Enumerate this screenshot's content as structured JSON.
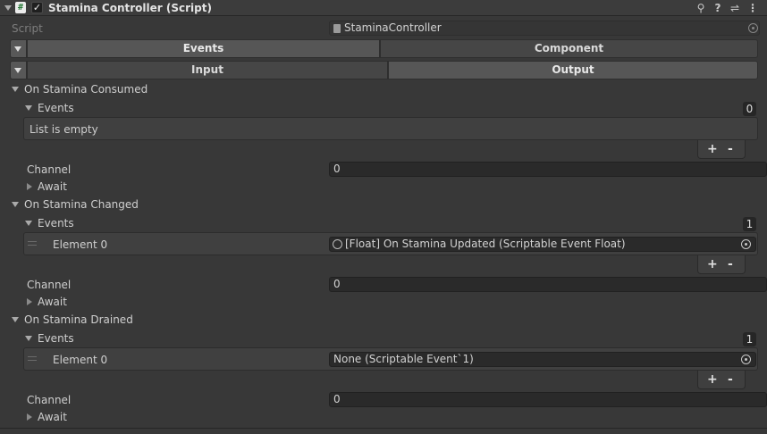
{
  "header": {
    "title": "Stamina Controller (Script)",
    "enabled": true,
    "icons": [
      "script-icon",
      "preset-search-icon",
      "help-icon",
      "settings-sliders-icon",
      "more-icon"
    ]
  },
  "script_field": {
    "label": "Script",
    "value": "StaminaController"
  },
  "top_tabs": [
    {
      "label": "Events",
      "active": true
    },
    {
      "label": "Component",
      "active": false
    }
  ],
  "sub_tabs": [
    {
      "label": "Input",
      "active": false
    },
    {
      "label": "Output",
      "active": true
    }
  ],
  "sections": [
    {
      "title": "On Stamina Consumed",
      "events_label": "Events",
      "count": "0",
      "empty_text": "List is empty",
      "channel_label": "Channel",
      "channel_value": "0",
      "await_label": "Await"
    },
    {
      "title": "On Stamina Changed",
      "events_label": "Events",
      "count": "1",
      "element_label": "Element 0",
      "element_value": "[Float] On Stamina Updated (Scriptable Event Float)",
      "channel_label": "Channel",
      "channel_value": "0",
      "await_label": "Await"
    },
    {
      "title": "On Stamina Drained",
      "events_label": "Events",
      "count": "1",
      "element_label": "Element 0",
      "element_value": "None (Scriptable Event`1)",
      "channel_label": "Channel",
      "channel_value": "0",
      "await_label": "Await"
    }
  ],
  "list_buttons": {
    "add": "+",
    "remove": "-"
  }
}
